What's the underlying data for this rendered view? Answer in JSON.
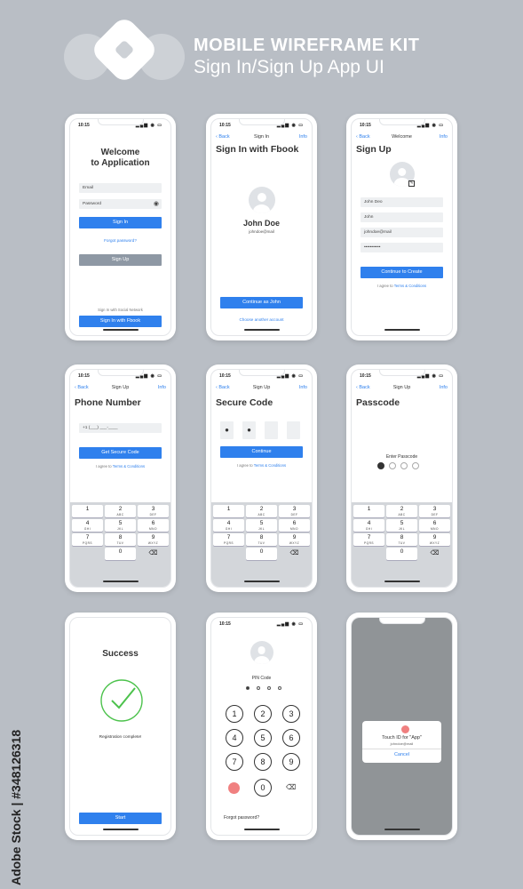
{
  "header": {
    "title": "MOBILE WIREFRAME KIT",
    "subtitle": "Sign In/Sign Up App UI",
    "logo_icon": "diamond-logo-icon"
  },
  "watermark": "Adobe Stock | #348126318",
  "status": {
    "time": "10:15",
    "indicators": "▂▄▆ ◉ ▭"
  },
  "screens": {
    "welcome": {
      "title_line1": "Welcome",
      "title_line2": "to Application",
      "email_placeholder": "Email",
      "password_placeholder": "Password",
      "signin_btn": "Sign In",
      "forgot": "Forgot password?",
      "signup_btn": "Sign Up",
      "social_caption": "Sign In with Social Network",
      "fbook_btn": "Sign In with Fbook"
    },
    "signin_fbook": {
      "back": "Back",
      "nav_title": "Sign In",
      "info": "Info",
      "title": "Sign In with Fbook",
      "name": "John Doe",
      "email": "johndoe@mail",
      "continue_btn": "Continue as John",
      "choose_other": "Choose another account"
    },
    "signup": {
      "back": "Back",
      "nav_title": "Welcome",
      "info": "Info",
      "title": "Sign Up",
      "full_name": "John Deo",
      "first_name": "John",
      "email": "johndoe@mail",
      "password": "•••••••••••",
      "create_btn": "Continue to Create",
      "terms_prefix": "I agree to",
      "terms_link": "Terms & Conditions"
    },
    "phone": {
      "back": "Back",
      "nav_title": "Sign Up",
      "info": "Info",
      "title": "Phone Number",
      "phone_value": "+1 (___) ___-____",
      "get_code_btn": "Get Secure Code",
      "terms_prefix": "I agree to",
      "terms_link": "Terms & Conditions"
    },
    "secure": {
      "back": "Back",
      "nav_title": "Sign Up",
      "info": "Info",
      "title": "Secure Code",
      "code": [
        "●",
        "●",
        "",
        ""
      ],
      "continue_btn": "Continue",
      "terms_prefix": "I agree to",
      "terms_link": "Terms & Conditions"
    },
    "passcode": {
      "back": "Back",
      "nav_title": "Sign Up",
      "info": "Info",
      "title": "Passcode",
      "enter_label": "Enter Passcode",
      "filled_count": 1,
      "total": 4
    },
    "success": {
      "title": "Success",
      "message": "Registration complete!",
      "start_btn": "Start"
    },
    "pin": {
      "label": "PIN Code",
      "keys": [
        "1",
        "2",
        "3",
        "4",
        "5",
        "6",
        "7",
        "8",
        "9"
      ],
      "zero": "0",
      "forgot": "Forgot password?"
    },
    "touchid": {
      "title": "Touch ID for \"App\"",
      "email": "johndoe@mail",
      "cancel": "Cancel"
    }
  },
  "keypad": [
    {
      "d": "1",
      "l": ""
    },
    {
      "d": "2",
      "l": "ABC"
    },
    {
      "d": "3",
      "l": "DEF"
    },
    {
      "d": "4",
      "l": "GHI"
    },
    {
      "d": "5",
      "l": "JKL"
    },
    {
      "d": "6",
      "l": "MNO"
    },
    {
      "d": "7",
      "l": "PQRS"
    },
    {
      "d": "8",
      "l": "TUV"
    },
    {
      "d": "9",
      "l": "WXYZ"
    },
    {
      "d": "",
      "l": ""
    },
    {
      "d": "0",
      "l": ""
    },
    {
      "d": "⌫",
      "l": ""
    }
  ],
  "colors": {
    "accent": "#2f80ed",
    "grey_button": "#8e98a4",
    "success": "#4cc24c",
    "touch": "#f08080"
  }
}
